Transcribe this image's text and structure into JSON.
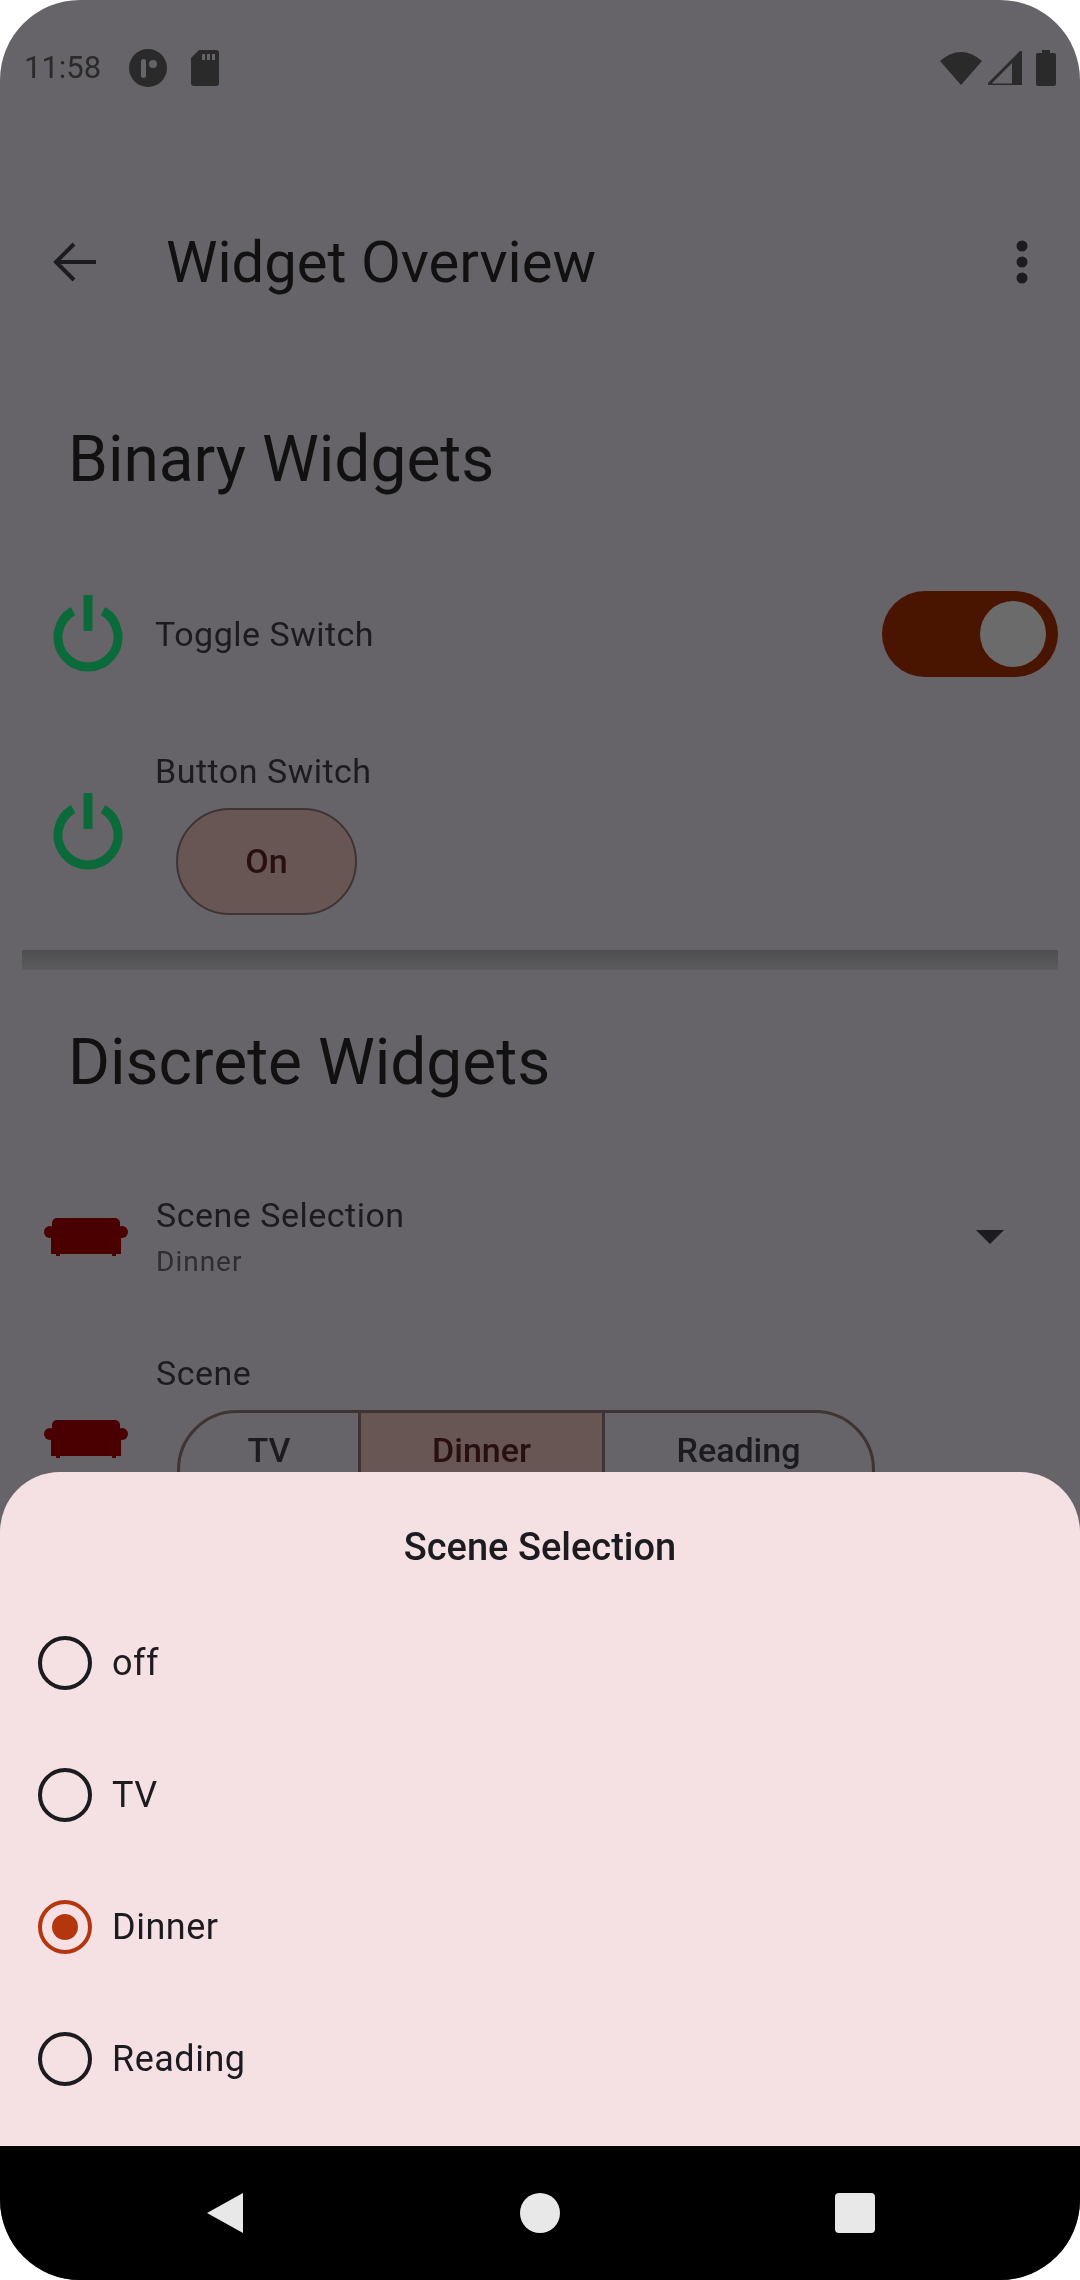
{
  "status_bar": {
    "time": "11:58"
  },
  "app_bar": {
    "title": "Widget Overview"
  },
  "sections": [
    {
      "title": "Binary Widgets",
      "items": [
        {
          "kind": "toggle",
          "label": "Toggle Switch",
          "on": true
        },
        {
          "kind": "button",
          "label": "Button Switch",
          "button": "On",
          "on": true
        }
      ]
    },
    {
      "title": "Discrete Widgets",
      "items": [
        {
          "kind": "dropdown",
          "label": "Scene Selection",
          "value": "Dinner"
        },
        {
          "kind": "segmented",
          "label": "Scene",
          "options": [
            {
              "label": "TV",
              "selected": false
            },
            {
              "label": "Dinner",
              "selected": true
            },
            {
              "label": "Reading",
              "selected": false
            }
          ]
        }
      ]
    }
  ],
  "bottom_sheet": {
    "title": "Scene Selection",
    "options": [
      {
        "label": "off",
        "selected": false
      },
      {
        "label": "TV",
        "selected": false
      },
      {
        "label": "Dinner",
        "selected": true
      },
      {
        "label": "Reading",
        "selected": false
      }
    ]
  }
}
